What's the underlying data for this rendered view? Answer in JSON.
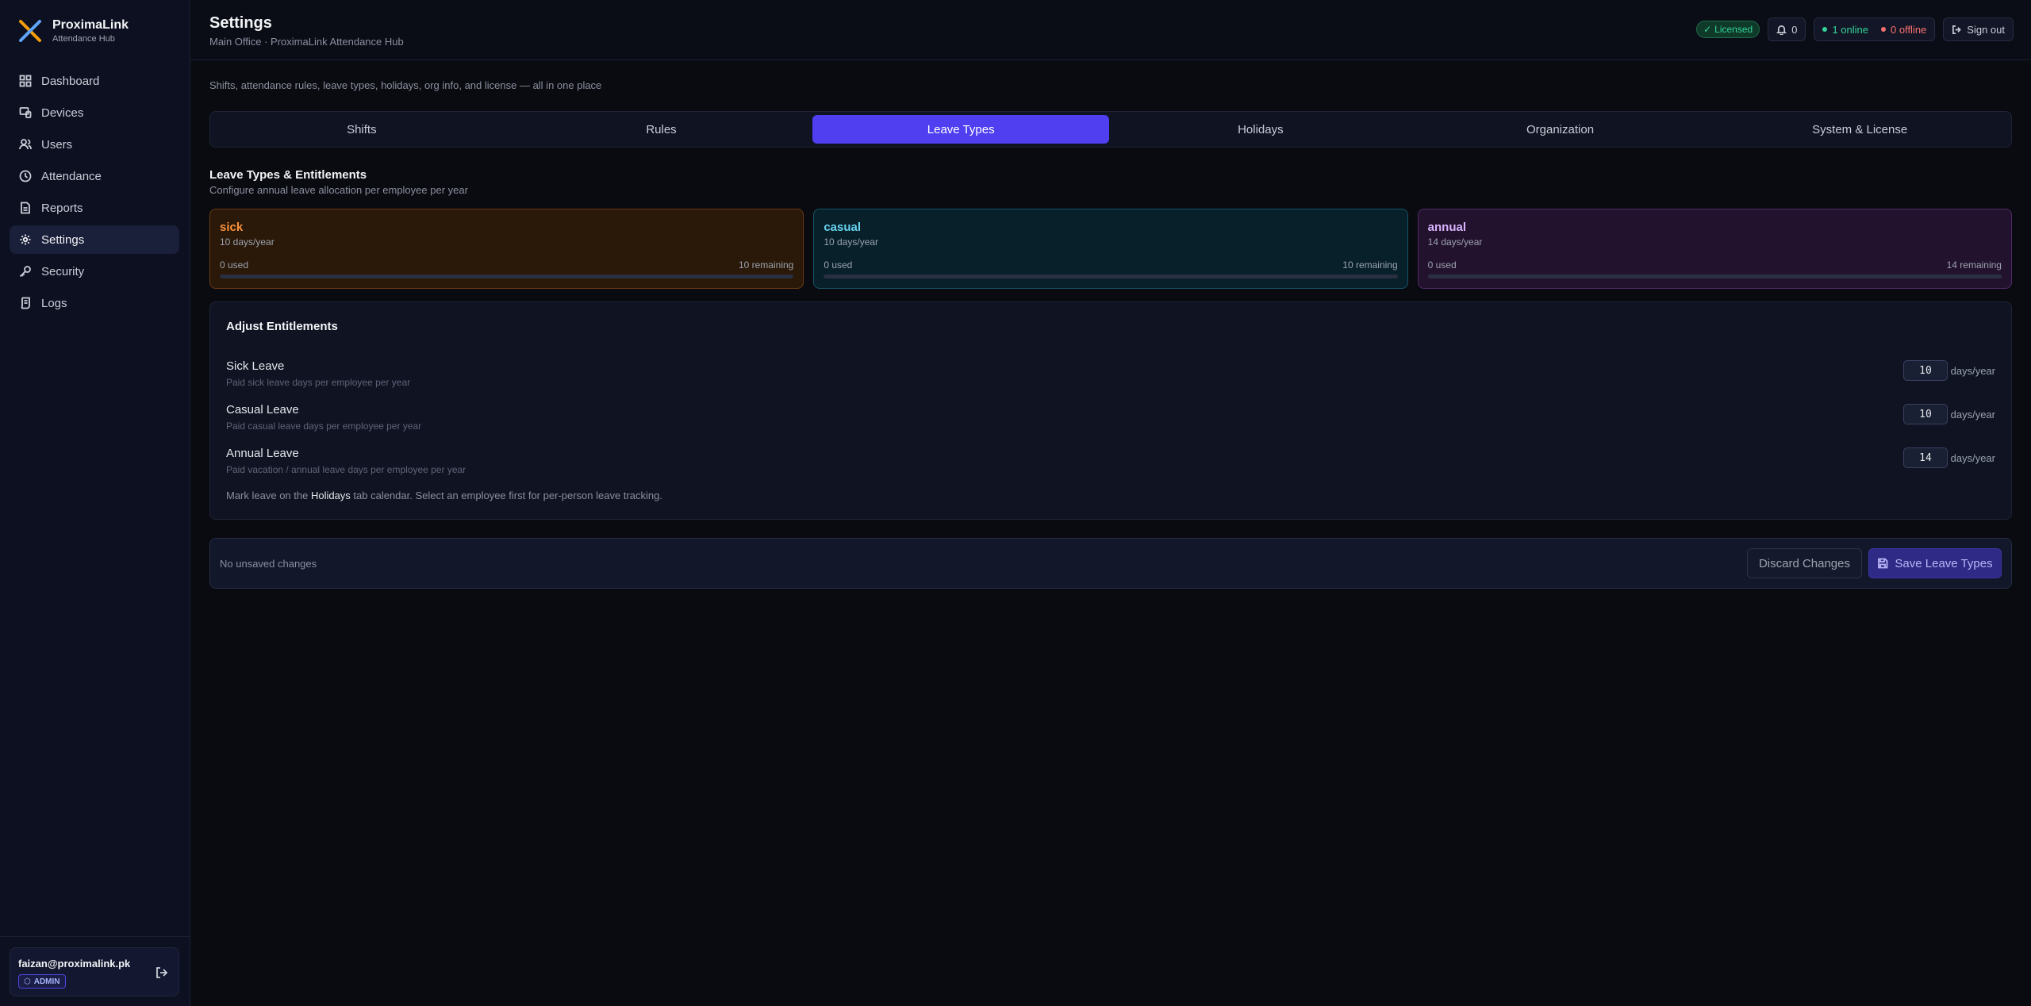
{
  "brand": {
    "name": "ProximaLink",
    "subtitle": "Attendance Hub"
  },
  "sidebar": {
    "items": [
      {
        "label": "Dashboard",
        "icon": "grid-icon"
      },
      {
        "label": "Devices",
        "icon": "devices-icon"
      },
      {
        "label": "Users",
        "icon": "users-icon"
      },
      {
        "label": "Attendance",
        "icon": "clock-icon"
      },
      {
        "label": "Reports",
        "icon": "document-icon"
      },
      {
        "label": "Settings",
        "icon": "gear-icon",
        "active": true
      },
      {
        "label": "Security",
        "icon": "key-icon"
      },
      {
        "label": "Logs",
        "icon": "scroll-icon"
      }
    ],
    "user": {
      "email": "faizan@proximalink.pk",
      "role": "ADMIN"
    }
  },
  "header": {
    "title": "Settings",
    "subtitle": "Main Office · ProximaLink Attendance Hub",
    "license_badge": "Licensed",
    "notifications": "0",
    "online": "1 online",
    "offline": "0 offline",
    "sign_out": "Sign out"
  },
  "main": {
    "intro": "Shifts, attendance rules, leave types, holidays, org info, and license — all in one place",
    "tabs": [
      {
        "label": "Shifts"
      },
      {
        "label": "Rules"
      },
      {
        "label": "Leave Types",
        "active": true
      },
      {
        "label": "Holidays"
      },
      {
        "label": "Organization"
      },
      {
        "label": "System & License"
      }
    ],
    "section_title": "Leave Types & Entitlements",
    "section_subtitle": "Configure annual leave allocation per employee per year",
    "leave_cards": [
      {
        "name": "sick",
        "days": "10 days/year",
        "used": "0 used",
        "remaining": "10 remaining",
        "used_fraction": 0
      },
      {
        "name": "casual",
        "days": "10 days/year",
        "used": "0 used",
        "remaining": "10 remaining",
        "used_fraction": 0
      },
      {
        "name": "annual",
        "days": "14 days/year",
        "used": "0 used",
        "remaining": "14 remaining",
        "used_fraction": 0
      }
    ],
    "adjust": {
      "title": "Adjust Entitlements",
      "rows": [
        {
          "label": "Sick Leave",
          "description": "Paid sick leave days per employee per year",
          "value": "10",
          "unit": "days/year"
        },
        {
          "label": "Casual Leave",
          "description": "Paid casual leave days per employee per year",
          "value": "10",
          "unit": "days/year"
        },
        {
          "label": "Annual Leave",
          "description": "Paid vacation / annual leave days per employee per year",
          "value": "14",
          "unit": "days/year"
        }
      ],
      "note_prefix": "Mark leave on the ",
      "note_link": "Holidays",
      "note_suffix": " tab calendar. Select an employee first for per-person leave tracking."
    },
    "savebar": {
      "status": "No unsaved changes",
      "discard_label": "Discard Changes",
      "save_label": "Save Leave Types"
    }
  },
  "colors": {
    "accent": "#4f3ff0",
    "sick": "#fb923c",
    "casual": "#67d3f0",
    "annual": "#d8b4fe",
    "online": "#34d399",
    "offline": "#f87171"
  }
}
